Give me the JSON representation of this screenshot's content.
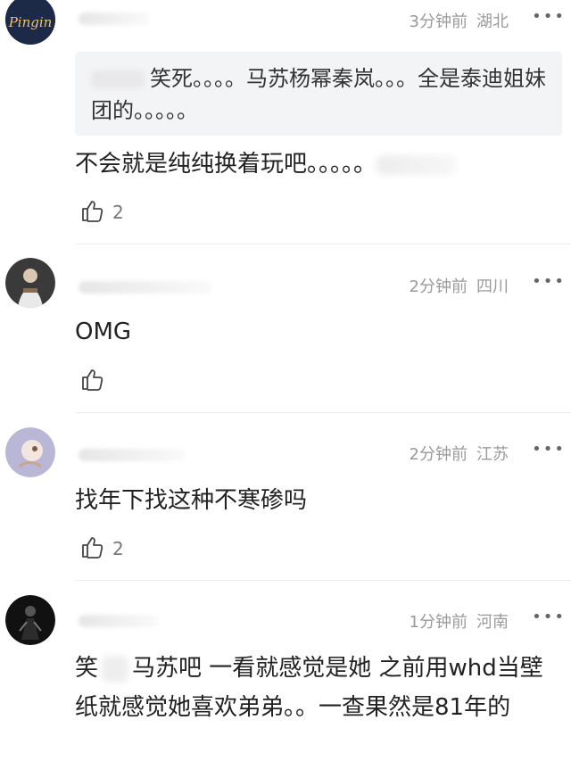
{
  "comments": [
    {
      "time": "3分钟前",
      "location": "湖北",
      "more": "•••",
      "quote": "笑死。。。。马苏杨幂秦岚。。。全是泰迪姐妹团的。。。。。",
      "text": "不会就是纯纯换着玩吧。。。。。",
      "likes": "2",
      "avatar_text": "Pingin"
    },
    {
      "time": "2分钟前",
      "location": "四川",
      "more": "•••",
      "text": "OMG",
      "likes": ""
    },
    {
      "time": "2分钟前",
      "location": "江苏",
      "more": "•••",
      "text": "找年下找这种不寒碜吗",
      "likes": "2"
    },
    {
      "time": "1分钟前",
      "location": "河南",
      "more": "•••",
      "text_a": "笑",
      "text_b": "马苏吧 一看就感觉是她 之前用whd当壁纸就感觉她喜欢弟弟。。一查果然是81年的"
    }
  ],
  "icons": {
    "like": "thumbs-up-icon",
    "more": "more-dots-icon"
  },
  "colors": {
    "meta": "#9a9a9a",
    "quote_bg": "#f3f4f6",
    "text": "#222222"
  }
}
